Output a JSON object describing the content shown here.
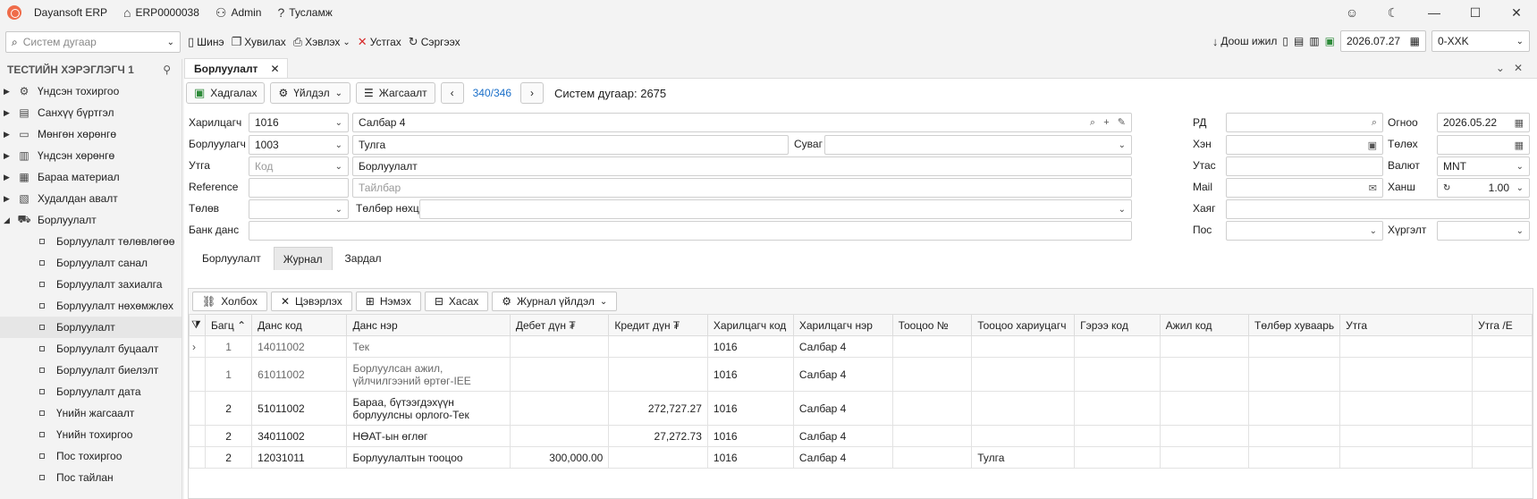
{
  "titlebar": {
    "app": "Dayansoft ERP",
    "company": "ERP0000038",
    "user": "Admin",
    "help": "Тусламж"
  },
  "toolbar": {
    "search_placeholder": "Систем дугаар",
    "new": "Шинэ",
    "copy": "Хувилах",
    "print": "Хэвлэх",
    "delete": "Устгах",
    "refresh": "Сэргээх",
    "down": "Доош ижил",
    "date": "2026.07.27",
    "branch": "0-XXK"
  },
  "sidebar": {
    "header": "ТЕСТИЙН ХЭРЭГЛЭГЧ 1",
    "items": [
      {
        "label": "Үндсэн тохиргоо",
        "icon": "gear-icon"
      },
      {
        "label": "Санхүү бүртгэл",
        "icon": "ledger-icon"
      },
      {
        "label": "Мөнгөн хөрөнгө",
        "icon": "cash-icon"
      },
      {
        "label": "Үндсэн хөрөнгө",
        "icon": "building-icon"
      },
      {
        "label": "Бараа материал",
        "icon": "box-icon"
      },
      {
        "label": "Худалдан авалт",
        "icon": "purchase-icon"
      },
      {
        "label": "Борлуулалт",
        "icon": "cart-icon"
      }
    ],
    "sub": [
      "Борлуулалт төлөвлөгөө",
      "Борлуулалт санал",
      "Борлуулалт захиалга",
      "Борлуулалт нөхөмжлөх",
      "Борлуулалт",
      "Борлуулалт буцаалт",
      "Борлуулалт биелэлт",
      "Борлуулалт дата",
      "Үнийн жагсаалт",
      "Үнийн тохиргоо",
      "Пос тохиргоо",
      "Пос тайлан"
    ]
  },
  "doc": {
    "tab": "Борлуулалт",
    "save": "Хадгалах",
    "action": "Үйлдэл",
    "list": "Жагсаалт",
    "page": "340/346",
    "sysno": "Систем дугаар: 2675"
  },
  "form": {
    "customer_lbl": "Харилцагч",
    "customer_code": "1016",
    "customer_name": "Салбар 4",
    "seller_lbl": "Борлуулагч",
    "seller_code": "1003",
    "seller_name": "Тулга",
    "channel_lbl": "Суваг",
    "note_lbl": "Утга",
    "note_code_ph": "Код",
    "note_val": "Борлуулалт",
    "ref_lbl": "Reference",
    "desc_ph": "Тайлбар",
    "pay_lbl": "Төлөв",
    "payterm_lbl": "Төлбөр нөхцөл",
    "bank_lbl": "Банк данс",
    "rd_lbl": "РД",
    "who_lbl": "Хэн",
    "phone_lbl": "Утас",
    "mail_lbl": "Mail",
    "addr_lbl": "Хаяг",
    "pos_lbl": "Пос",
    "date_lbl": "Огноо",
    "date_val": "2026.05.22",
    "paydate_lbl": "Төлөх",
    "cur_lbl": "Валют",
    "cur_val": "MNT",
    "rate_lbl": "Ханш",
    "rate_val": "1.00",
    "deliv_lbl": "Хүргэлт"
  },
  "subtabs": [
    "Борлуулалт",
    "Журнал",
    "Зардал"
  ],
  "grid": {
    "buttons": [
      "Холбох",
      "Цэвэрлэх",
      "Нэмэх",
      "Хасах",
      "Журнал үйлдэл"
    ],
    "columns": [
      "Багц",
      "Данс код",
      "Данс нэр",
      "Дебет дүн ₮",
      "Кредит дүн ₮",
      "Харилцагч код",
      "Харилцагч нэр",
      "Тооцоо №",
      "Тооцоо хариуцагч",
      "Гэрээ код",
      "Ажил код",
      "Төлбөр хуваарь",
      "Утга",
      "Утга /E"
    ],
    "rows": [
      {
        "b": "1",
        "code": "14011002",
        "name": "Тек",
        "debit": "",
        "credit": "",
        "ccode": "1016",
        "cname": "Салбар 4",
        "resp": ""
      },
      {
        "b": "1",
        "code": "61011002",
        "name": "Борлуулсан ажил, үйлчилгээний өртөг-IEE",
        "debit": "",
        "credit": "",
        "ccode": "1016",
        "cname": "Салбар 4",
        "resp": ""
      },
      {
        "b": "2",
        "code": "51011002",
        "name": "Бараа, бүтээгдэхүүн борлуулсны орлого-Тек",
        "debit": "",
        "credit": "272,727.27",
        "ccode": "1016",
        "cname": "Салбар 4",
        "resp": ""
      },
      {
        "b": "2",
        "code": "34011002",
        "name": "НӨАТ-ын өглөг",
        "debit": "",
        "credit": "27,272.73",
        "ccode": "1016",
        "cname": "Салбар 4",
        "resp": ""
      },
      {
        "b": "2",
        "code": "12031011",
        "name": "Борлуулалтын тооцоо",
        "debit": "300,000.00",
        "credit": "",
        "ccode": "1016",
        "cname": "Салбар 4",
        "resp": "Тулга"
      }
    ]
  }
}
